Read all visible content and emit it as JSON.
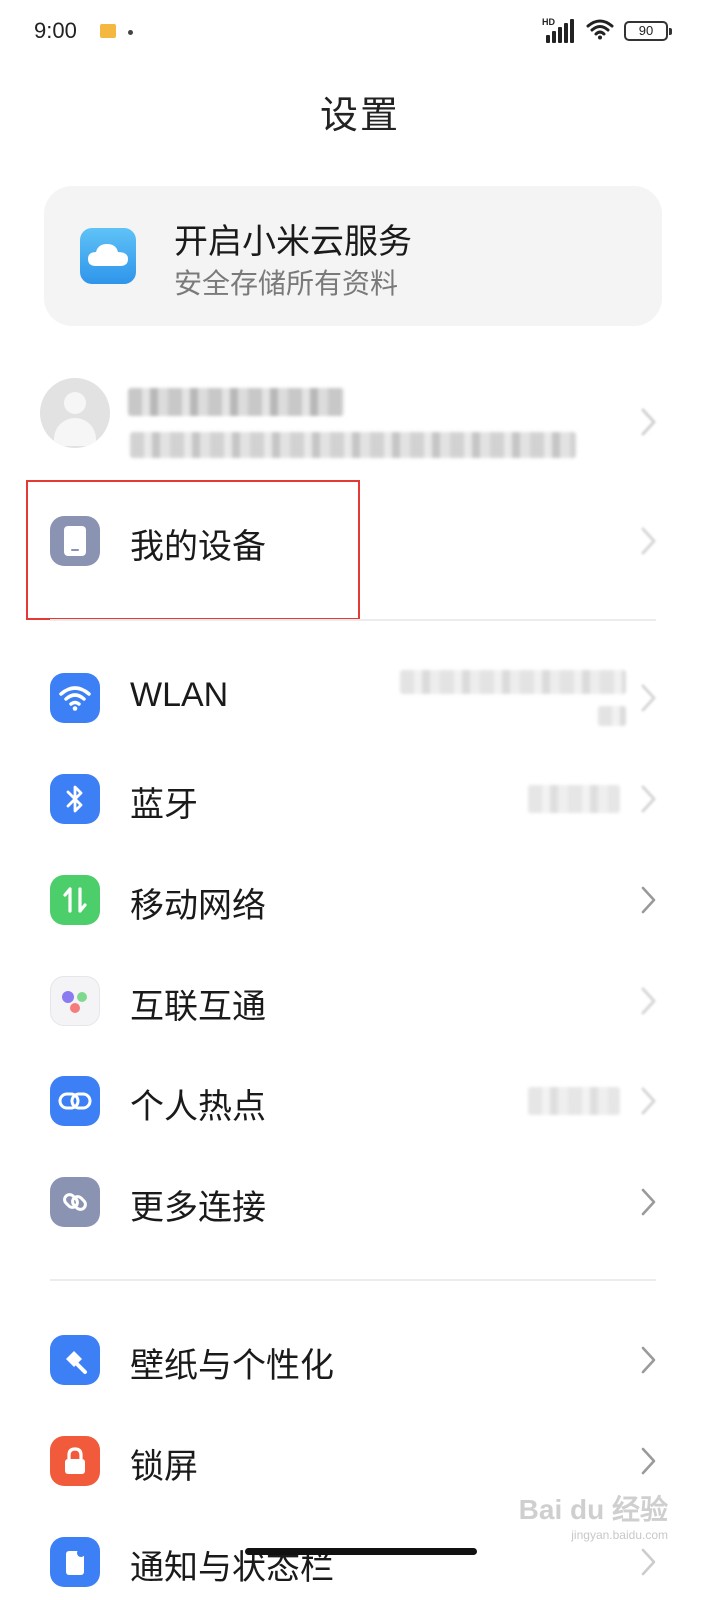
{
  "status_bar": {
    "time": "9:00",
    "network_badge": "HD",
    "battery": "90"
  },
  "page": {
    "title": "设置"
  },
  "cloud": {
    "title": "开启小米云服务",
    "subtitle": "安全存储所有资料"
  },
  "rows": {
    "my_device": "我的设备",
    "wlan": "WLAN",
    "bluetooth": "蓝牙",
    "mobile_network": "移动网络",
    "interconnect": "互联互通",
    "hotspot": "个人热点",
    "more_connections": "更多连接",
    "wallpaper": "壁纸与个性化",
    "lock_screen": "锁屏",
    "notifications": "通知与状态栏"
  },
  "watermark": {
    "main": "Bai du 经验",
    "sub": "jingyan.baidu.com"
  },
  "colors": {
    "wlan_icon": "#3d7ff5",
    "bluetooth_icon": "#3d7ff5",
    "mobile_icon": "#4cce6b",
    "hotspot_icon": "#3d7ff5",
    "more_icon": "#8b93b3",
    "device_icon": "#8b93b3",
    "wallpaper_icon": "#3d7ff5",
    "lock_icon": "#f25a3c",
    "annotation_box": "#e53935"
  }
}
